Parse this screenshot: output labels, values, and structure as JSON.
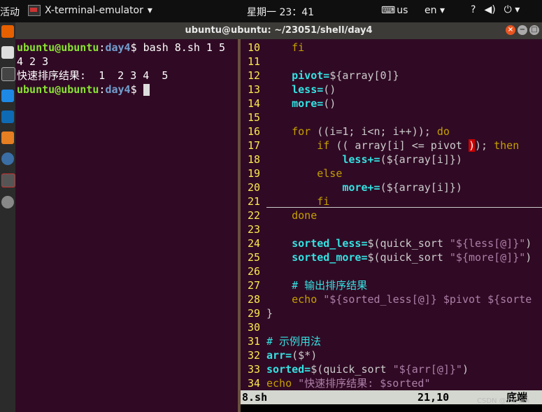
{
  "topbar": {
    "activities": "活动",
    "app_name": "X-terminal-emulator",
    "clock": "星期一 23：41",
    "keyboard": "us",
    "lang": "en"
  },
  "window": {
    "title": "ubuntu@ubuntu: ~/23051/shell/day4"
  },
  "terminal": {
    "user": "ubuntu@ubuntu",
    "path": "day4",
    "cmd": "$ bash 8.sh 1 5",
    "out1": "4 2 3",
    "out2": "快速排序结果:  1  2 3 4  5",
    "prompt_end": "$ "
  },
  "editor": {
    "lines": [
      {
        "n": "10",
        "t": "    fi"
      },
      {
        "n": "11",
        "t": ""
      },
      {
        "n": "12",
        "t": "    pivot=${array[0]}"
      },
      {
        "n": "13",
        "t": "    less=()"
      },
      {
        "n": "14",
        "t": "    more=()"
      },
      {
        "n": "15",
        "t": ""
      },
      {
        "n": "16",
        "t": "    for ((i=1; i<n; i++)); do"
      },
      {
        "n": "17",
        "t": "        if (( array[i] <= pivot )); then"
      },
      {
        "n": "18",
        "t": "            less+=(${array[i]})"
      },
      {
        "n": "19",
        "t": "        else"
      },
      {
        "n": "20",
        "t": "            more+=(${array[i]})"
      },
      {
        "n": "21",
        "t": "        fi"
      },
      {
        "n": "22",
        "t": "    done"
      },
      {
        "n": "23",
        "t": ""
      },
      {
        "n": "24",
        "t": "    sorted_less=$(quick_sort \"${less[@]}\")"
      },
      {
        "n": "25",
        "t": "    sorted_more=$(quick_sort \"${more[@]}\")"
      },
      {
        "n": "26",
        "t": ""
      },
      {
        "n": "27",
        "t": "    # 输出排序结果"
      },
      {
        "n": "28",
        "t": "    echo \"${sorted_less[@]} $pivot ${sorte"
      },
      {
        "n": "29",
        "t": "}"
      },
      {
        "n": "30",
        "t": ""
      },
      {
        "n": "31",
        "t": "# 示例用法"
      },
      {
        "n": "32",
        "t": "arr=($*)"
      },
      {
        "n": "33",
        "t": "sorted=$(quick_sort \"${arr[@]}\")"
      },
      {
        "n": "34",
        "t": "echo \"快速排序结果: $sorted\""
      }
    ],
    "status": {
      "filename": "8.sh",
      "position": "21,10",
      "scroll": "底端"
    }
  },
  "watermark": "CSDN @Yn_um",
  "colors": {
    "terminal_bg": "#300a24",
    "prompt_user": "#8ae234",
    "prompt_path": "#729fcf",
    "line_numbers": "#fce94f"
  }
}
